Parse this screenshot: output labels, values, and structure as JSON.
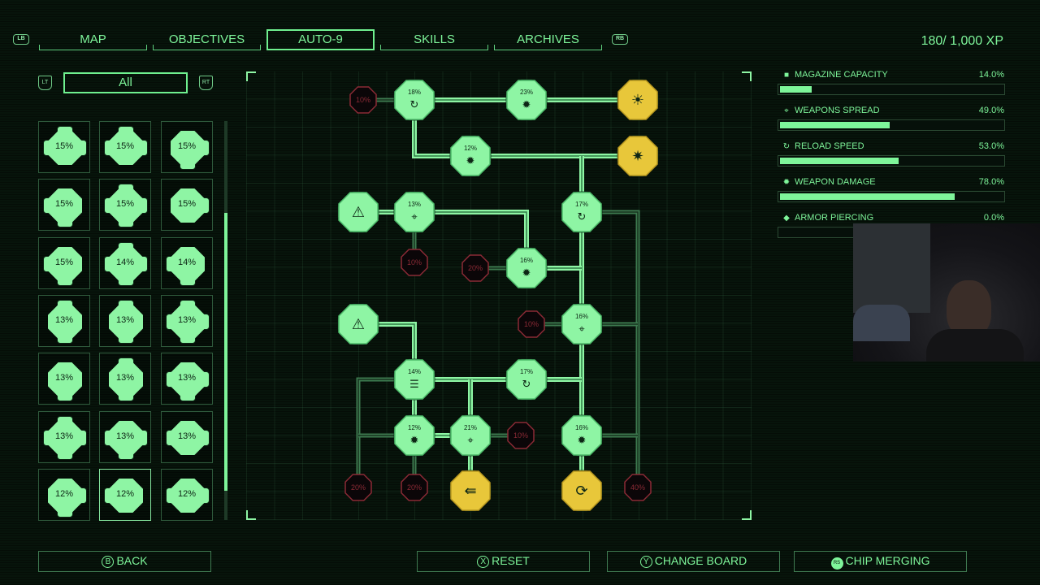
{
  "tabs": {
    "left_bumper": "LB",
    "right_bumper": "RB",
    "items": [
      {
        "label": "MAP",
        "active": false
      },
      {
        "label": "OBJECTIVES",
        "active": false
      },
      {
        "label": "AUTO-9",
        "active": true
      },
      {
        "label": "SKILLS",
        "active": false
      },
      {
        "label": "ARCHIVES",
        "active": false
      }
    ]
  },
  "xp": {
    "text": "180/ 1,000 XP",
    "current": 180,
    "max": 1000
  },
  "filter": {
    "left_trigger": "LT",
    "right_trigger": "RT",
    "value": "All"
  },
  "chips": [
    {
      "value": "15%",
      "nubs": [
        "t",
        "l",
        "r"
      ]
    },
    {
      "value": "15%",
      "nubs": [
        "t",
        "l",
        "r"
      ]
    },
    {
      "value": "15%",
      "nubs": [
        "r",
        "b"
      ]
    },
    {
      "value": "15%",
      "nubs": [
        "l",
        "b"
      ]
    },
    {
      "value": "15%",
      "nubs": [
        "t",
        "l",
        "r",
        "b"
      ]
    },
    {
      "value": "15%",
      "nubs": [
        "r"
      ]
    },
    {
      "value": "15%",
      "nubs": [
        "l",
        "b"
      ]
    },
    {
      "value": "14%",
      "nubs": [
        "t",
        "l",
        "r",
        "b"
      ]
    },
    {
      "value": "14%",
      "nubs": [
        "l",
        "b"
      ]
    },
    {
      "value": "13%",
      "nubs": [
        "t",
        "b"
      ]
    },
    {
      "value": "13%",
      "nubs": [
        "t",
        "b"
      ]
    },
    {
      "value": "13%",
      "nubs": [
        "t",
        "l",
        "r",
        "b"
      ]
    },
    {
      "value": "13%",
      "nubs": [
        "b"
      ]
    },
    {
      "value": "13%",
      "nubs": [
        "t",
        "b"
      ]
    },
    {
      "value": "13%",
      "nubs": [
        "l",
        "r",
        "b"
      ]
    },
    {
      "value": "13%",
      "nubs": [
        "t",
        "l",
        "r",
        "b"
      ]
    },
    {
      "value": "13%",
      "nubs": [
        "l",
        "r",
        "b"
      ]
    },
    {
      "value": "13%",
      "nubs": [
        "l",
        "r"
      ]
    },
    {
      "value": "12%",
      "nubs": [
        "r",
        "b"
      ]
    },
    {
      "value": "12%",
      "nubs": [
        "l"
      ],
      "selected": true
    },
    {
      "value": "12%",
      "nubs": [
        "l",
        "r"
      ]
    }
  ],
  "board": {
    "nodes": [
      {
        "id": "n1",
        "value": "10%",
        "state": "locked",
        "icon": ""
      },
      {
        "id": "n2",
        "value": "18%",
        "state": "filled",
        "icon": "reload-icon"
      },
      {
        "id": "n3",
        "value": "23%",
        "state": "filled",
        "icon": "damage-icon"
      },
      {
        "id": "n4",
        "value": "",
        "state": "special",
        "icon": "explosive-round-icon"
      },
      {
        "id": "n5",
        "value": "12%",
        "state": "filled",
        "icon": "damage-icon"
      },
      {
        "id": "n6",
        "value": "",
        "state": "special",
        "icon": "splatter-icon"
      },
      {
        "id": "n7",
        "value": "",
        "state": "power",
        "icon": "power-triangle-icon"
      },
      {
        "id": "n8",
        "value": "13%",
        "state": "filled",
        "icon": "crosshair-icon"
      },
      {
        "id": "n9",
        "value": "17%",
        "state": "filled",
        "icon": "reload-icon"
      },
      {
        "id": "n10",
        "value": "10%",
        "state": "locked",
        "icon": ""
      },
      {
        "id": "n11",
        "value": "20%",
        "state": "locked",
        "icon": ""
      },
      {
        "id": "n12",
        "value": "16%",
        "state": "filled",
        "icon": "damage-icon"
      },
      {
        "id": "n13",
        "value": "",
        "state": "power",
        "icon": "power-triangle-icon"
      },
      {
        "id": "n14",
        "value": "10%",
        "state": "locked",
        "icon": ""
      },
      {
        "id": "n15",
        "value": "16%",
        "state": "filled",
        "icon": "crosshair-icon"
      },
      {
        "id": "n16",
        "value": "14%",
        "state": "filled",
        "icon": "magazine-icon"
      },
      {
        "id": "n17",
        "value": "17%",
        "state": "filled",
        "icon": "reload-icon"
      },
      {
        "id": "n18",
        "value": "12%",
        "state": "filled",
        "icon": "damage-icon"
      },
      {
        "id": "n19",
        "value": "21%",
        "state": "filled",
        "icon": "crosshair-icon"
      },
      {
        "id": "n20",
        "value": "10%",
        "state": "locked",
        "icon": ""
      },
      {
        "id": "n21",
        "value": "16%",
        "state": "filled",
        "icon": "damage-icon"
      },
      {
        "id": "n22",
        "value": "20%",
        "state": "locked",
        "icon": ""
      },
      {
        "id": "n23",
        "value": "20%",
        "state": "locked",
        "icon": ""
      },
      {
        "id": "n24",
        "value": "",
        "state": "special",
        "icon": "spread-shot-icon"
      },
      {
        "id": "n25",
        "value": "",
        "state": "special",
        "icon": "auto-reload-icon"
      },
      {
        "id": "n26",
        "value": "40%",
        "state": "locked",
        "icon": ""
      }
    ]
  },
  "stats": [
    {
      "icon": "magazine-icon",
      "label": "MAGAZINE CAPACITY",
      "value": "14.0%",
      "percent": 14.0
    },
    {
      "icon": "crosshair-icon",
      "label": "WEAPONS SPREAD",
      "value": "49.0%",
      "percent": 49.0
    },
    {
      "icon": "reload-icon",
      "label": "RELOAD SPEED",
      "value": "53.0%",
      "percent": 53.0
    },
    {
      "icon": "damage-icon",
      "label": "WEAPON DAMAGE",
      "value": "78.0%",
      "percent": 78.0
    },
    {
      "icon": "armor-icon",
      "label": "ARMOR PIERCING",
      "value": "0.0%",
      "percent": 0.0
    }
  ],
  "buttons": {
    "back": {
      "glyph": "B",
      "label": "BACK"
    },
    "reset": {
      "glyph": "X",
      "label": "RESET"
    },
    "change_board": {
      "glyph": "Y",
      "label": "CHANGE BOARD"
    },
    "chip_merging": {
      "glyph": "RS",
      "label": "CHIP MERGING"
    }
  },
  "colors": {
    "accent": "#7ef59a",
    "locked": "#8a2a35",
    "special": "#e8c73a",
    "background": "#07140b"
  }
}
